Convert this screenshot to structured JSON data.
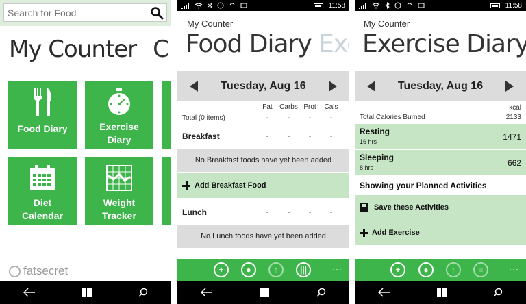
{
  "screen1": {
    "search_placeholder": "Search for Food",
    "title": "My Counter",
    "title_peek": "C",
    "tiles": [
      {
        "label_line1": "Food",
        "label_line2": "Diary",
        "icon": "fork-knife-icon"
      },
      {
        "label_line1": "Exercise",
        "label_line2": "Diary",
        "icon": "stopwatch-icon"
      },
      {
        "label_line1": "Diet",
        "label_line2": "Calendar",
        "icon": "calendar-icon"
      },
      {
        "label_line1": "Weight",
        "label_line2": "Tracker",
        "icon": "chart-grid-icon"
      }
    ],
    "brand": "fatsecret"
  },
  "status": {
    "time": "11:58"
  },
  "screen2": {
    "app_name": "My Counter",
    "title": "Food Diary",
    "title_next": "Exe",
    "date": "Tuesday, Aug 16",
    "columns": [
      "Fat",
      "Carbs",
      "Prot",
      "Cals"
    ],
    "total_label": "Total (0 items)",
    "dash": "-",
    "breakfast": {
      "heading": "Breakfast",
      "empty": "No Breakfast foods have yet been added",
      "add": "Add Breakfast Food"
    },
    "lunch": {
      "heading": "Lunch",
      "empty": "No Lunch foods have yet been added"
    },
    "more": "···"
  },
  "screen3": {
    "app_name": "My Counter",
    "title": "Exercise Diary",
    "title_next": "",
    "date": "Tuesday, Aug 16",
    "kcal_label": "kcal",
    "total_label": "Total Calories Burned",
    "total_value": "2133",
    "activities": [
      {
        "name": "Resting",
        "duration": "16 hrs",
        "value": "1471"
      },
      {
        "name": "Sleeping",
        "duration": "8 hrs",
        "value": "662"
      }
    ],
    "planned_label": "Showing your Planned Activities",
    "save_label": "Save these Activities",
    "add_label": "Add Exercise",
    "more": "···"
  },
  "colors": {
    "accent": "#3db54a",
    "accent_light": "#c5e5c5",
    "gray_band": "#dcdcdc"
  }
}
